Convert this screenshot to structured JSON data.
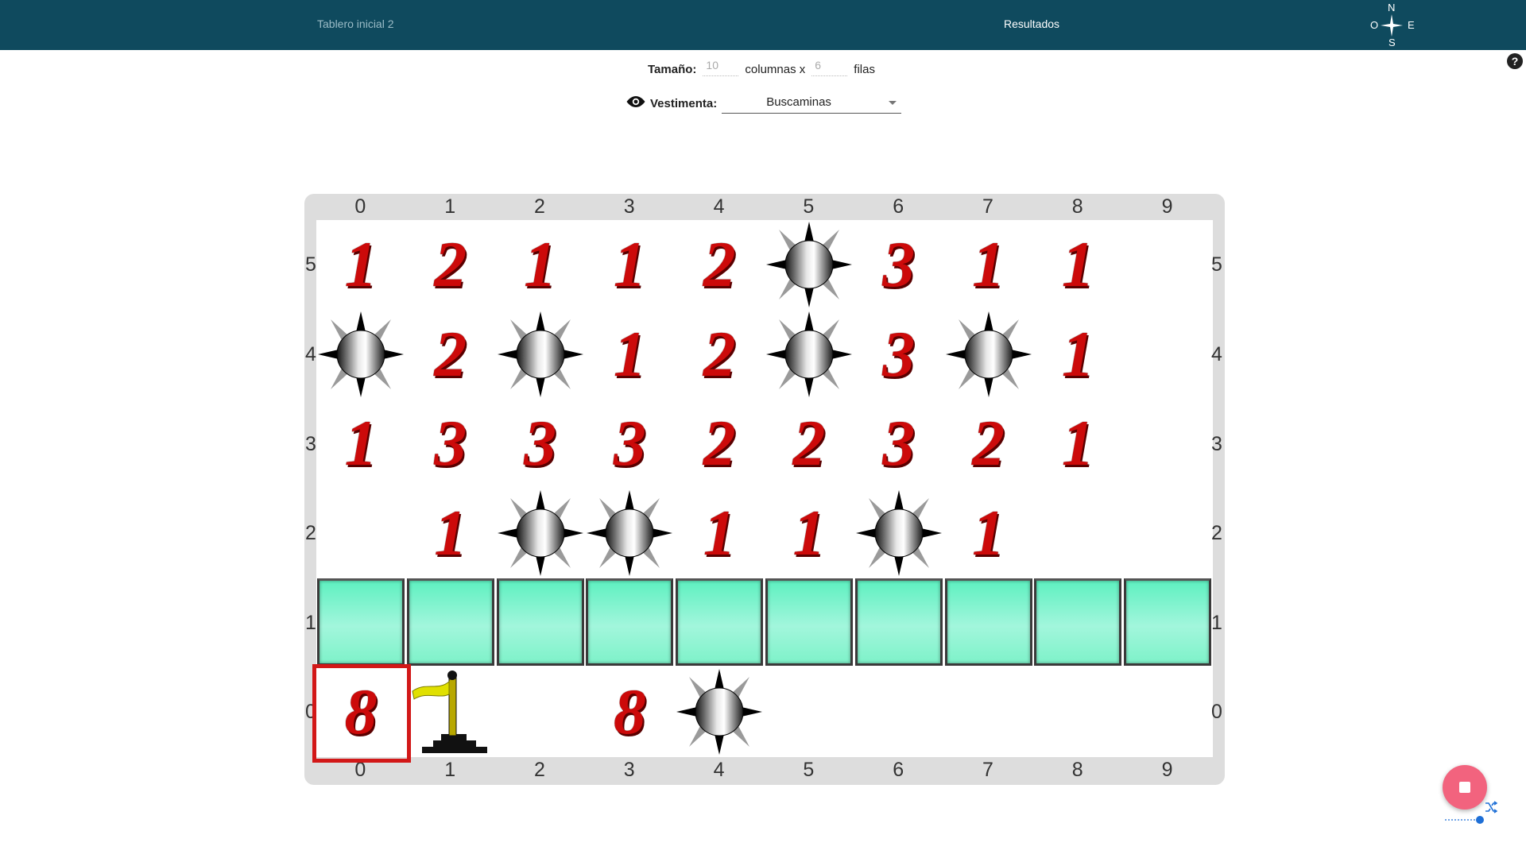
{
  "topbar": {
    "tab_initial": "Tablero inicial 2",
    "tab_results": "Resultados",
    "compass": {
      "n": "N",
      "s": "S",
      "o": "O",
      "e": "E"
    }
  },
  "size": {
    "label": "Tamaño:",
    "columns_value": "10",
    "columns_label": "columnas x",
    "rows_value": "6",
    "rows_label": "filas"
  },
  "outfit": {
    "label": "Vestimenta:",
    "selected": "Buscaminas"
  },
  "board": {
    "column_labels": [
      "0",
      "1",
      "2",
      "3",
      "4",
      "5",
      "6",
      "7",
      "8",
      "9"
    ],
    "row_labels": [
      "5",
      "4",
      "3",
      "2",
      "1",
      "0"
    ],
    "rows": [
      [
        "1",
        "2",
        "1",
        "1",
        "2",
        "mine",
        "3",
        "1",
        "1",
        ""
      ],
      [
        "mine",
        "2",
        "mine",
        "1",
        "2",
        "mine",
        "3",
        "mine",
        "1",
        ""
      ],
      [
        "1",
        "3",
        "3",
        "3",
        "2",
        "2",
        "3",
        "2",
        "1",
        ""
      ],
      [
        "",
        "1",
        "mine",
        "mine",
        "1",
        "1",
        "mine",
        "1",
        "",
        ""
      ],
      [
        "tile",
        "tile",
        "tile",
        "tile",
        "tile",
        "tile",
        "tile",
        "tile",
        "tile",
        "tile"
      ],
      [
        "8",
        "flag",
        "",
        "8",
        "mine",
        "",
        "",
        "",
        "",
        ""
      ]
    ],
    "cursor": {
      "row": "0",
      "col": "0"
    }
  },
  "colors": {
    "topbar": "#0f4a5e",
    "number": "#cc0a0a",
    "tile": "#7ef2c9",
    "cursor": "#d21818",
    "stop_button": "#f2637e",
    "slider": "#1e6fd6"
  },
  "icons": [
    "eye-icon",
    "compass-icon",
    "help-icon",
    "mine-icon",
    "flag-icon",
    "stop-icon",
    "shuffle-icon"
  ]
}
